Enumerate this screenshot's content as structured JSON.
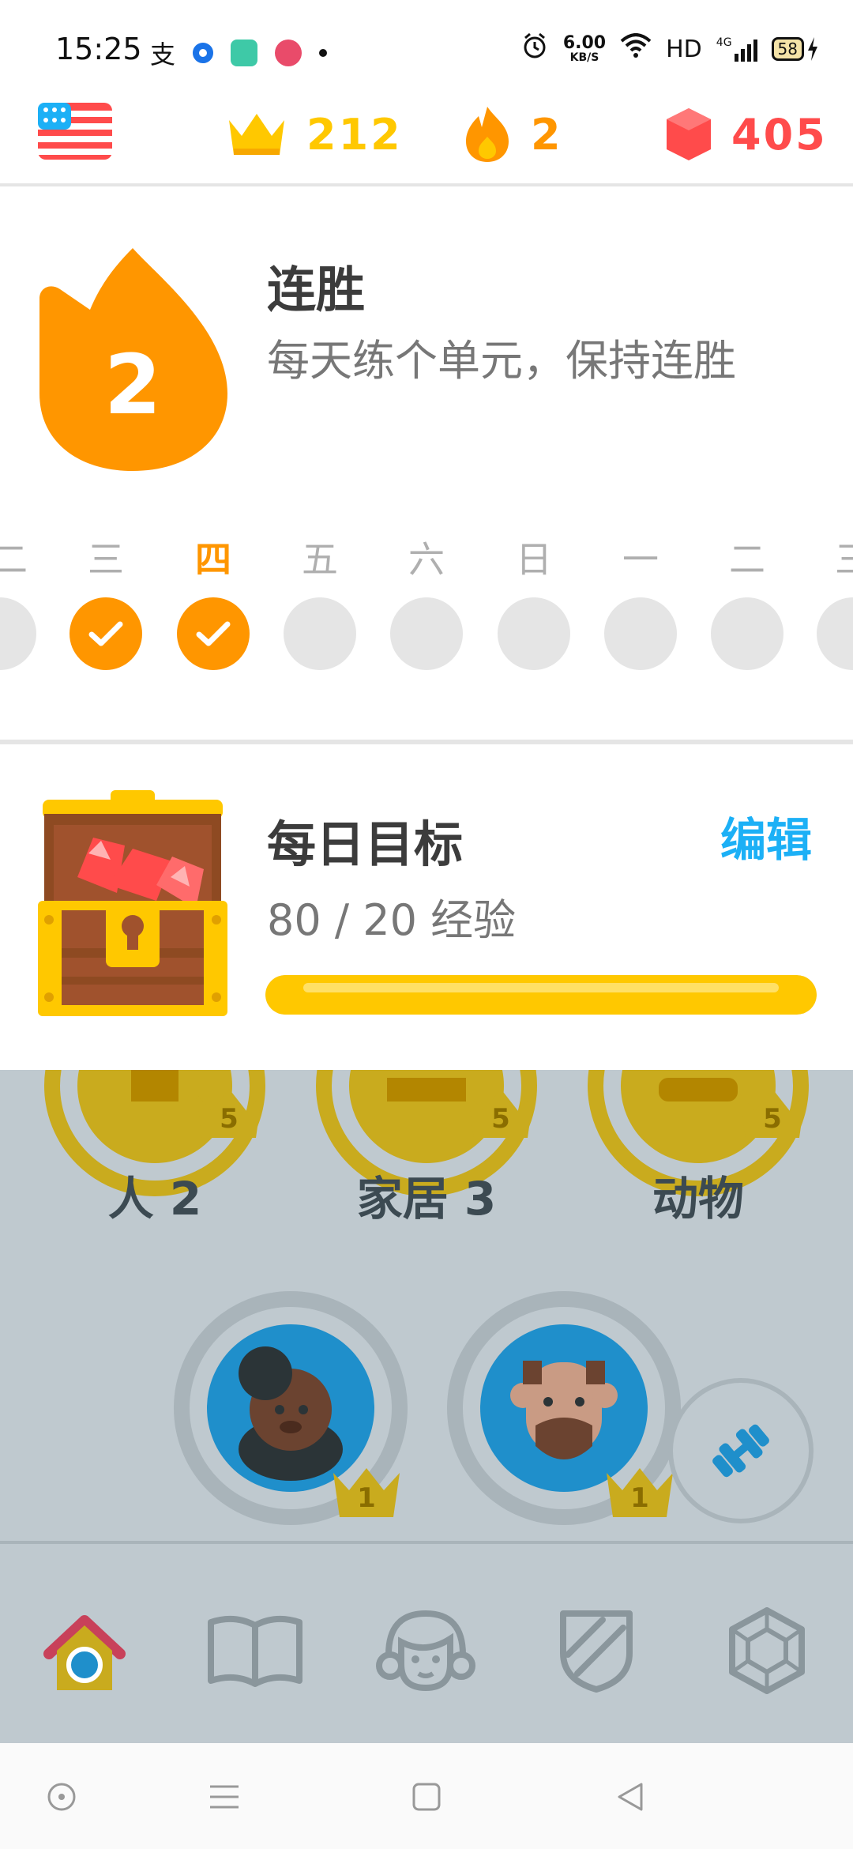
{
  "status_bar": {
    "time": "15:25",
    "speed_value": "6.00",
    "speed_unit": "KB/S",
    "hd": "HD",
    "network": "4G",
    "battery": "58"
  },
  "topbar": {
    "crowns": "212",
    "streak": "2",
    "gems": "405",
    "colors": {
      "crown": "#ffc800",
      "streak": "#ff9600",
      "gem": "#ff4b4b"
    }
  },
  "streak_panel": {
    "count": "2",
    "title": "连胜",
    "subtitle": "每天练个单元，保持连胜",
    "days": [
      {
        "label": "二",
        "done": false
      },
      {
        "label": "三",
        "done": true
      },
      {
        "label": "四",
        "done": true,
        "today": true
      },
      {
        "label": "五",
        "done": false
      },
      {
        "label": "六",
        "done": false
      },
      {
        "label": "日",
        "done": false
      },
      {
        "label": "一",
        "done": false
      },
      {
        "label": "二",
        "done": false
      },
      {
        "label": "三",
        "done": false
      }
    ]
  },
  "daily_goal": {
    "title": "每日目标",
    "edit_label": "编辑",
    "progress_text": "80 / 20 经验",
    "progress_fraction": 1.0
  },
  "path": {
    "skills_row": [
      {
        "label": "人 2",
        "crown_level": "5"
      },
      {
        "label": "家居 3",
        "crown_level": "5"
      },
      {
        "label": "动物",
        "crown_level": "5"
      }
    ],
    "nodes": [
      {
        "crown_level": "1",
        "icon": "woman-avatar-icon"
      },
      {
        "crown_level": "1",
        "icon": "man-avatar-icon"
      }
    ]
  },
  "tabs": [
    {
      "name": "home",
      "icon": "home-icon",
      "active": true
    },
    {
      "name": "stories",
      "icon": "book-icon"
    },
    {
      "name": "profile",
      "icon": "profile-icon"
    },
    {
      "name": "leagues",
      "icon": "shield-icon"
    },
    {
      "name": "shop",
      "icon": "shop-icon"
    }
  ]
}
